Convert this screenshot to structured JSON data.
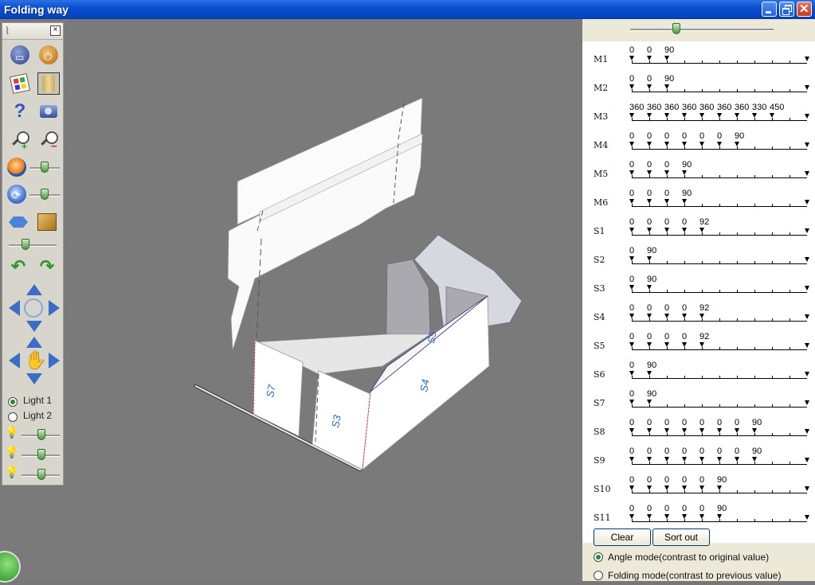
{
  "window": {
    "title": "Folding way"
  },
  "toolbar": {
    "lights": [
      "Light 1",
      "Light 2"
    ],
    "selected_light": "Light 1",
    "slider_levels": {
      "zoom": 0.5,
      "rotate": 0.5,
      "size": 0.4,
      "light1": 0.5,
      "light2": 0.5,
      "light3": 0.5
    }
  },
  "model": {
    "panel_labels": [
      "S7",
      "S3",
      "S4",
      "S5"
    ]
  },
  "right_panel": {
    "top_slider_level": 0.3,
    "rows": [
      {
        "label": "M1",
        "values": [
          "0",
          "0",
          "90"
        ]
      },
      {
        "label": "M2",
        "values": [
          "0",
          "0",
          "90"
        ]
      },
      {
        "label": "M3",
        "values": [
          "360",
          "360",
          "360",
          "360",
          "360",
          "360",
          "360",
          "330",
          "450"
        ]
      },
      {
        "label": "M4",
        "values": [
          "0",
          "0",
          "0",
          "0",
          "0",
          "0",
          "90"
        ]
      },
      {
        "label": "M5",
        "values": [
          "0",
          "0",
          "0",
          "90"
        ]
      },
      {
        "label": "M6",
        "values": [
          "0",
          "0",
          "0",
          "90"
        ]
      },
      {
        "label": "S1",
        "values": [
          "0",
          "0",
          "0",
          "0",
          "92"
        ]
      },
      {
        "label": "S2",
        "values": [
          "0",
          "90"
        ]
      },
      {
        "label": "S3",
        "values": [
          "0",
          "90"
        ]
      },
      {
        "label": "S4",
        "values": [
          "0",
          "0",
          "0",
          "0",
          "92"
        ]
      },
      {
        "label": "S5",
        "values": [
          "0",
          "0",
          "0",
          "0",
          "92"
        ]
      },
      {
        "label": "S6",
        "values": [
          "0",
          "90"
        ]
      },
      {
        "label": "S7",
        "values": [
          "0",
          "90"
        ]
      },
      {
        "label": "S8",
        "values": [
          "0",
          "0",
          "0",
          "0",
          "0",
          "0",
          "0",
          "90"
        ]
      },
      {
        "label": "S9",
        "values": [
          "0",
          "0",
          "0",
          "0",
          "0",
          "0",
          "0",
          "90"
        ]
      },
      {
        "label": "S10",
        "values": [
          "0",
          "0",
          "0",
          "0",
          "0",
          "90"
        ]
      },
      {
        "label": "S11",
        "values": [
          "0",
          "0",
          "0",
          "0",
          "0",
          "90"
        ]
      }
    ],
    "clear_label": "Clear",
    "sort_label": "Sort out",
    "mode_angle": "Angle mode(contrast to original value)",
    "mode_folding": "Folding mode(contrast to previous value)",
    "selected_mode": "angle"
  }
}
